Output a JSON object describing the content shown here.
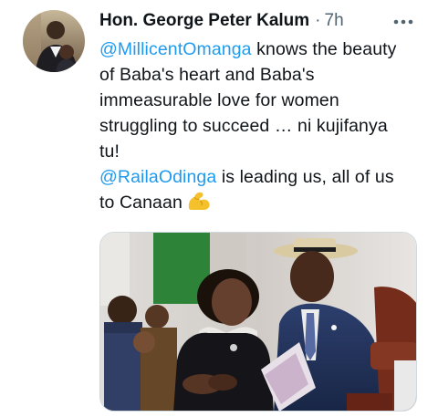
{
  "tweet": {
    "author": {
      "display_name": "Hon. George Peter Kalum",
      "avatar_icon": "profile-photo"
    },
    "separator": "·",
    "timestamp": "7h",
    "more_icon": "more-horizontal-icon",
    "body": {
      "mention_1": "@MillicentOmanga",
      "line_1_rest": " knows the beauty",
      "line_2": "of Baba's heart and Baba's",
      "line_3": "immeasurable love for women",
      "line_4": "struggling to succeed … ni kujifanya",
      "line_5": "tu!",
      "mention_2": "@RailaOdinga",
      "line_6_rest": " is leading us, all of us",
      "line_7": "to Canaan",
      "emoji_icon": "flexed-biceps-emoji"
    },
    "media": {
      "type": "photo"
    }
  },
  "colors": {
    "text": "#0f1419",
    "secondary": "#536471",
    "link": "#1d9bf0",
    "border": "#cfd9de"
  }
}
